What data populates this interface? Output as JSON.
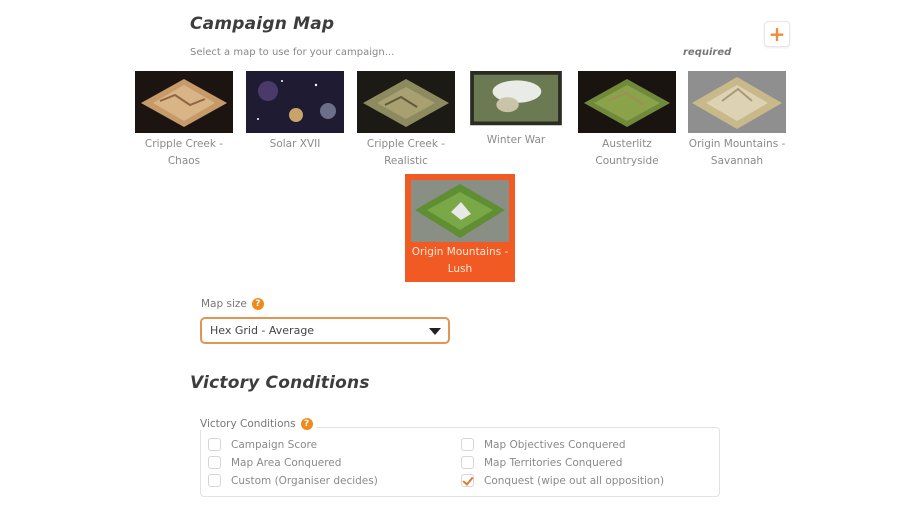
{
  "campaign_map": {
    "title": "Campaign Map",
    "subtitle": "Select a map to use for your campaign...",
    "required_label": "required",
    "add_icon": "plus-icon",
    "maps": [
      {
        "label": "Cripple Creek - Chaos",
        "selected": false
      },
      {
        "label": "Solar XVII",
        "selected": false
      },
      {
        "label": "Cripple Creek - Realistic",
        "selected": false
      },
      {
        "label": "Winter War",
        "selected": false
      },
      {
        "label": "Austerlitz Countryside",
        "selected": false
      },
      {
        "label": "Origin Mountains - Savannah",
        "selected": false
      },
      {
        "label": "Origin Mountains - Lush",
        "selected": true
      }
    ]
  },
  "map_size": {
    "label": "Map size",
    "value": "Hex Grid - Average"
  },
  "victory": {
    "title": "Victory Conditions",
    "legend": "Victory Conditions",
    "options": [
      {
        "label": "Campaign Score",
        "checked": false
      },
      {
        "label": "Map Area Conquered",
        "checked": false
      },
      {
        "label": "Custom (Organiser decides)",
        "checked": false
      },
      {
        "label": "Map Objectives Conquered",
        "checked": false
      },
      {
        "label": "Map Territories Conquered",
        "checked": false
      },
      {
        "label": "Conquest (wipe out all opposition)",
        "checked": true
      }
    ]
  },
  "colors": {
    "accent": "#f15a22",
    "help": "#f08a1a"
  }
}
